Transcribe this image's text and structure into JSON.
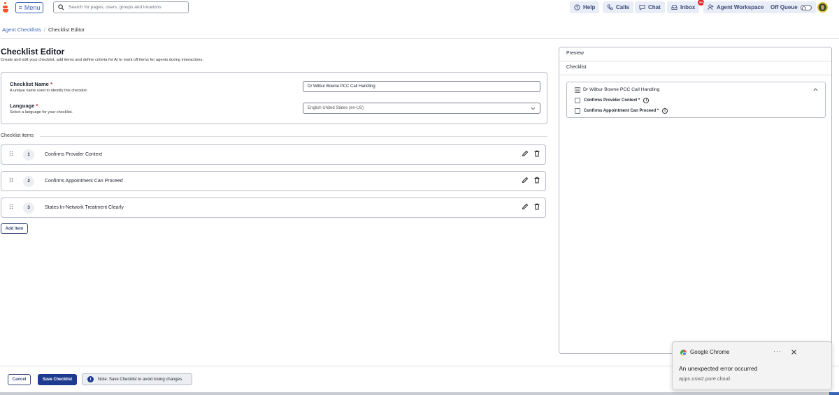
{
  "topbar": {
    "menu_label": "Menu",
    "search_placeholder": "Search for pages, users, groups and locations",
    "help_label": "Help",
    "calls_label": "Calls",
    "chat_label": "Chat",
    "inbox_label": "Inbox",
    "inbox_badge": "9+",
    "workspace_label": "Agent Workspace",
    "queue_label": "Off Queue"
  },
  "breadcrumb": {
    "parent": "Agent Checklists",
    "separator": "/",
    "current": "Checklist Editor"
  },
  "page": {
    "title": "Checklist Editor",
    "description": "Create and edit your checklist, add items and define criteria for AI to mark off items for agents during interactions."
  },
  "form": {
    "name_label": "Checklist Name",
    "name_help": "A unique name used to identify this checklist.",
    "name_value": "Dr Wilbur Bowne  PCC Call Handling",
    "language_label": "Language",
    "language_help": "Select a language for your checklist.",
    "language_value": "English United States (en-US)",
    "required_mark": "*"
  },
  "items_section": {
    "label": "Checklist items",
    "items": [
      {
        "number": "1",
        "label": "Confirms Provider Context"
      },
      {
        "number": "2",
        "label": "Confirms Appointment Can Proceed"
      },
      {
        "number": "3",
        "label": "States In-Network Treatment Clearly"
      }
    ],
    "add_label": "Add item"
  },
  "preview": {
    "header": "Preview",
    "subheader": "Checklist",
    "card_title": "Dr Wilbur Bowne PCC Call Handling",
    "rows": [
      {
        "label": "Confirms Provider Context *"
      },
      {
        "label": "Confirms Appointment Can Proceed *"
      }
    ]
  },
  "footer": {
    "cancel_label": "Cancel",
    "save_label": "Save Checklist",
    "note_text": "Note: Save Checklist to avoid losing changes."
  },
  "notification": {
    "app": "Google Chrome",
    "more": "···",
    "title": "An unexpected error occurred",
    "source": "apps.usw2.pure.cloud"
  },
  "colors": {
    "accent": "#3a63b8",
    "primary_button": "#1f3b8f",
    "logo": "#ff4f1f",
    "badge": "#e02424"
  }
}
